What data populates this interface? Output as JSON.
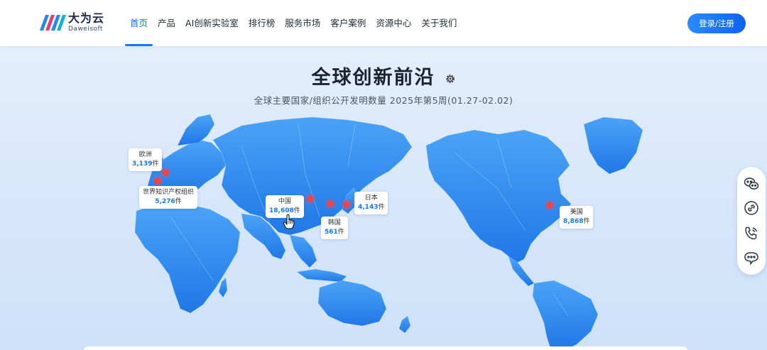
{
  "brand": {
    "name_cn": "大为云",
    "name_en": "Daweisoft"
  },
  "nav": {
    "items": [
      {
        "label": "首页",
        "active": true
      },
      {
        "label": "产品"
      },
      {
        "label": "AI创新实验室"
      },
      {
        "label": "排行榜"
      },
      {
        "label": "服务市场"
      },
      {
        "label": "客户案例"
      },
      {
        "label": "资源中心"
      },
      {
        "label": "关于我们"
      }
    ],
    "login_label": "登录/注册"
  },
  "hero": {
    "title": "全球创新前沿",
    "subtitle": "全球主要国家/组织公开发明数量 2025年第5周(01.27-02.02)"
  },
  "callouts": [
    {
      "name": "欧洲",
      "value": "3,139",
      "unit": "件"
    },
    {
      "name": "世界知识产权组织",
      "value": "5,276",
      "unit": "件"
    },
    {
      "name": "中国",
      "value": "18,608",
      "unit": "件"
    },
    {
      "name": "日本",
      "value": "4,143",
      "unit": "件"
    },
    {
      "name": "韩国",
      "value": "561",
      "unit": "件"
    },
    {
      "name": "美国",
      "value": "8,868",
      "unit": "件"
    }
  ],
  "side_tools": [
    "wechat-icon",
    "link-icon",
    "phone-icon",
    "chat-icon"
  ],
  "colors": {
    "accent": "#1677ff",
    "map_land": "#2f8bf0",
    "hotspot": "#ff4040"
  }
}
